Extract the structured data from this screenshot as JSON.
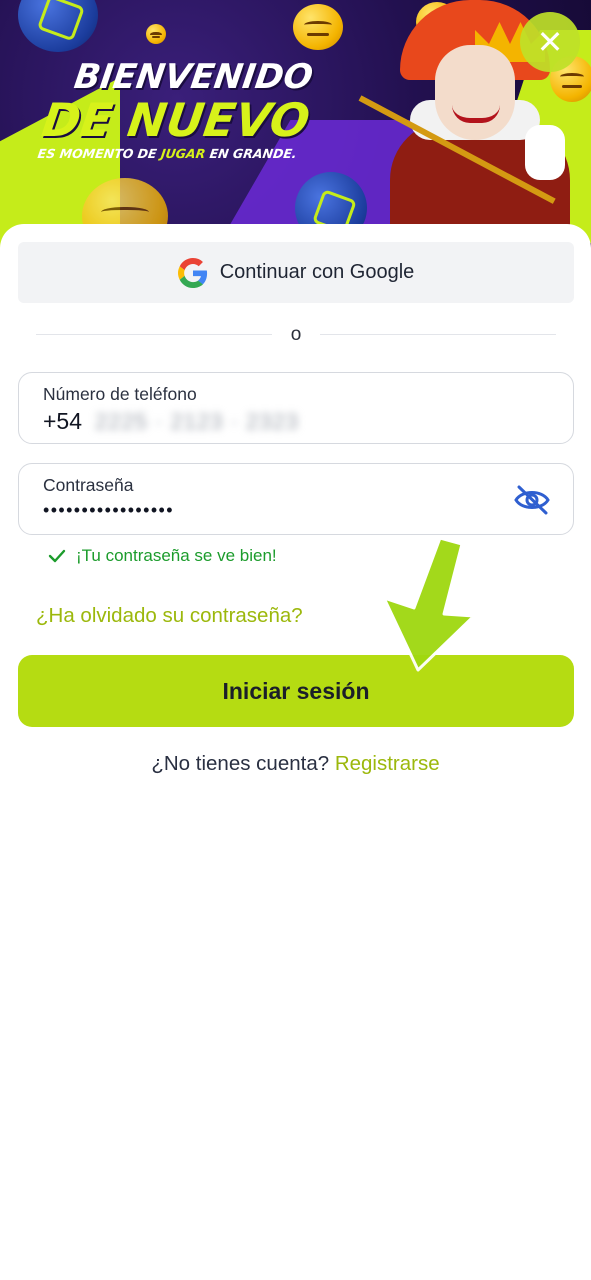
{
  "banner": {
    "title_line1": "BIENVENIDO",
    "title_line2": "DE NUEVO",
    "subtitle_pre": "ES MOMENTO DE ",
    "subtitle_highlight": "JUGAR",
    "subtitle_post": " EN GRANDE."
  },
  "close": {
    "icon": "close-icon",
    "label": "✕"
  },
  "google": {
    "label": "Continuar con Google",
    "icon": "google-logo-icon"
  },
  "divider": {
    "text": "o"
  },
  "phone": {
    "label": "Número de teléfono",
    "prefix": "+54",
    "masked_value": "2225 · 2123 · 2323"
  },
  "password": {
    "label": "Contraseña",
    "value_dots": "•••••••••••••••••",
    "toggle_icon": "eye-off-icon"
  },
  "validation": {
    "icon": "checkmark-icon",
    "message": "¡Tu contraseña se ve bien!"
  },
  "forgot": {
    "label": "¿Ha olvidado su contraseña?"
  },
  "login": {
    "label": "Iniciar sesión"
  },
  "register": {
    "prompt": "¿No tienes cuenta? ",
    "link": "Registrarse"
  },
  "colors": {
    "accent": "#b5dc12",
    "link": "#9cb80c",
    "success": "#1c9c2c",
    "eye_icon": "#2f5fd0",
    "banner_bg": "#22104f"
  }
}
